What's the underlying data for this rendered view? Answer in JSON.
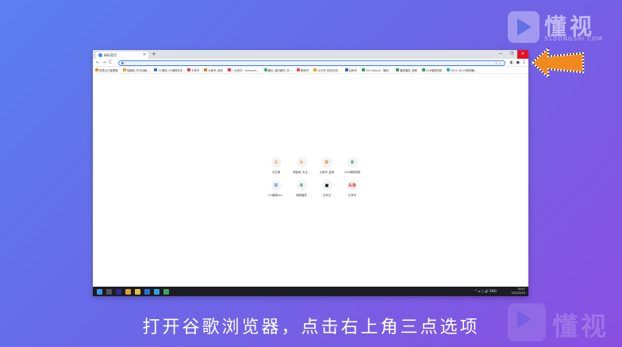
{
  "logo": {
    "text": "懂视",
    "sub": "51DONGSHI.COM"
  },
  "browser": {
    "tab_title": "新标签页",
    "tab_close": "×",
    "new_tab": "+",
    "window_controls": [
      "—",
      "❐",
      "✕"
    ],
    "nav": [
      "←",
      "→",
      "C"
    ],
    "bookmarks": [
      {
        "label": "阿里云已被屏蔽",
        "color": "#e0902a"
      },
      {
        "label": "电脑网_专注电脑...",
        "color": "#f0a030"
      },
      {
        "label": "51懂视_51懂视资讯",
        "color": "#3b6fd8"
      },
      {
        "label": "头条号",
        "color": "#e04040"
      },
      {
        "label": "大鱼号_官网",
        "color": "#f07020"
      },
      {
        "label": "一点资讯 - Ixihuxnn...",
        "color": "#e04030"
      },
      {
        "label": "趣玩_我的稿件_作...",
        "color": "#3ab06a"
      },
      {
        "label": "微信号",
        "color": "#e05050"
      },
      {
        "label": "今日号_轻松在线...",
        "color": "#f0a030"
      },
      {
        "label": "百家号",
        "color": "#3060d0"
      },
      {
        "label": "23 millions - 懂视...",
        "color": "#2aa060"
      },
      {
        "label": "懂视播发_视频",
        "color": "#2aa060"
      },
      {
        "label": "234懂视视频",
        "color": "#2aa060"
      },
      {
        "label": "2022-06-16视频截...",
        "color": "#3aa0d0"
      }
    ],
    "shortcuts": [
      {
        "label": "今日懂",
        "icon": "G",
        "color": "#f0a030"
      },
      {
        "label": "电脑网_专注...",
        "icon": "b",
        "color": "#f0a030"
      },
      {
        "label": "大鱼号_官网",
        "icon": "D",
        "color": "#f07020"
      },
      {
        "label": "234懂视视频",
        "icon": "B",
        "color": "#2aa060"
      },
      {
        "label": "51懂视Bai...",
        "icon": "D",
        "color": "#4a6ee0"
      },
      {
        "label": "懂视播发",
        "icon": "B",
        "color": "#2aa060"
      },
      {
        "label": "分享记",
        "icon": "■",
        "color": "#222222"
      },
      {
        "label": "头条号",
        "icon": "头条",
        "color": "#e04040"
      }
    ]
  },
  "taskbar": {
    "tray_icons": "^ ⌂ ◻ 🔊 ENG",
    "time": "18:47",
    "date": "2022/5/24"
  },
  "caption": "打开谷歌浏览器，点击右上角三点选项"
}
